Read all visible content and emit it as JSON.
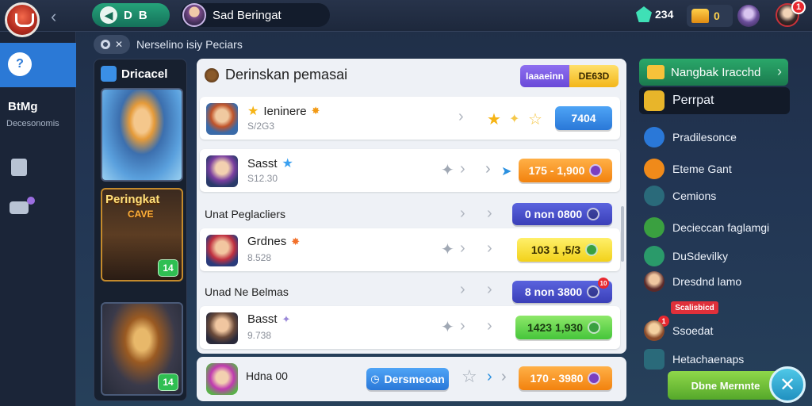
{
  "topbar": {
    "nav_label": "D",
    "nav_label2": "B",
    "user_name": "Sad Beringat",
    "gems": "234",
    "chest_count": "0",
    "notif_badge": "1"
  },
  "subheader": {
    "text": "Nerselino isiy Peciars"
  },
  "rail": {
    "label": "BtMg",
    "sub": "Decesonomis"
  },
  "heroes": {
    "title": "Dricacel",
    "cards": [
      {
        "title": "",
        "sub": "",
        "level": ""
      },
      {
        "title": "Peringkat",
        "sub": "CAVE",
        "level": "14"
      },
      {
        "title": "",
        "sub": "",
        "level": "14"
      }
    ]
  },
  "panel": {
    "title": "Derinskan pemasai",
    "toggle_a": "Iaaaeinn",
    "toggle_b": "DE63D",
    "rows": [
      {
        "name": "Ieninere",
        "sub": "S/2G3",
        "button": "7404"
      },
      {
        "name": "Sasst",
        "sub": "S12.30",
        "button": "175 - 1,900"
      },
      {
        "name": "Grdnes",
        "sub": "8.528",
        "button": "103 1 ,5/3"
      },
      {
        "name": "Basst",
        "sub": "9.738",
        "button": "1423 1,930"
      }
    ],
    "sections": [
      {
        "label": "Unat Peglacliers",
        "button": "0 non 0800"
      },
      {
        "label": "Unad Ne Belmas",
        "button": "8 non 3800",
        "badge": "10"
      }
    ],
    "bottom": {
      "name": "Hdna 00",
      "pill": "Dersmeoan",
      "button": "170 - 3980"
    }
  },
  "menu": {
    "top": "Nangbak Iracchd",
    "items": [
      "Perrpat",
      "Pradilesonce",
      "Eteme Gant",
      "Cemions",
      "Decieccan faglamgi",
      "DuSdevilky",
      "Dresdnd lamo",
      "Ssoedat",
      "Hetachaenaps"
    ],
    "promo": "Scalisbicd",
    "green_button": "Dbne Mernnte",
    "badge": "1"
  },
  "colors": {
    "accent_blue": "#2b79d6",
    "panel_bg": "#eef1f6",
    "menu_green": "#2aa86a"
  }
}
